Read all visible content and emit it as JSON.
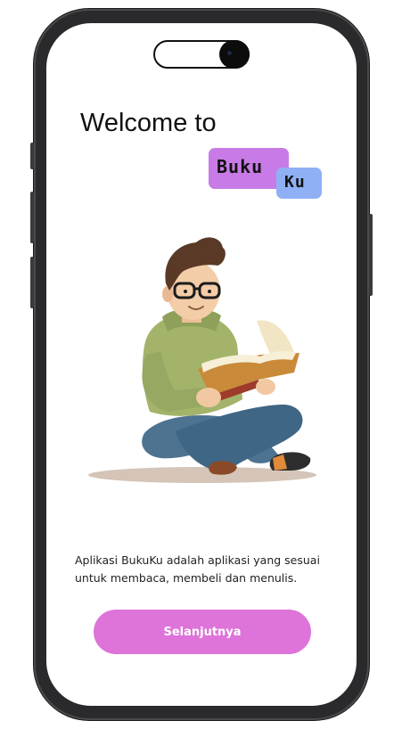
{
  "welcome": {
    "title": "Welcome to"
  },
  "logo": {
    "part1": "Buku",
    "part2": "Ku"
  },
  "illustration": {
    "icon": "person-reading-book-illustration"
  },
  "description": {
    "line1": "Aplikasi BukuKu adalah aplikasi yang sesuai",
    "line2": "untuk membaca, membeli dan menulis."
  },
  "actions": {
    "next_label": "Selanjutnya"
  },
  "colors": {
    "logo_purple": "#c87be6",
    "logo_blue": "#8fb0f4",
    "button_pink": "#de74d9"
  }
}
